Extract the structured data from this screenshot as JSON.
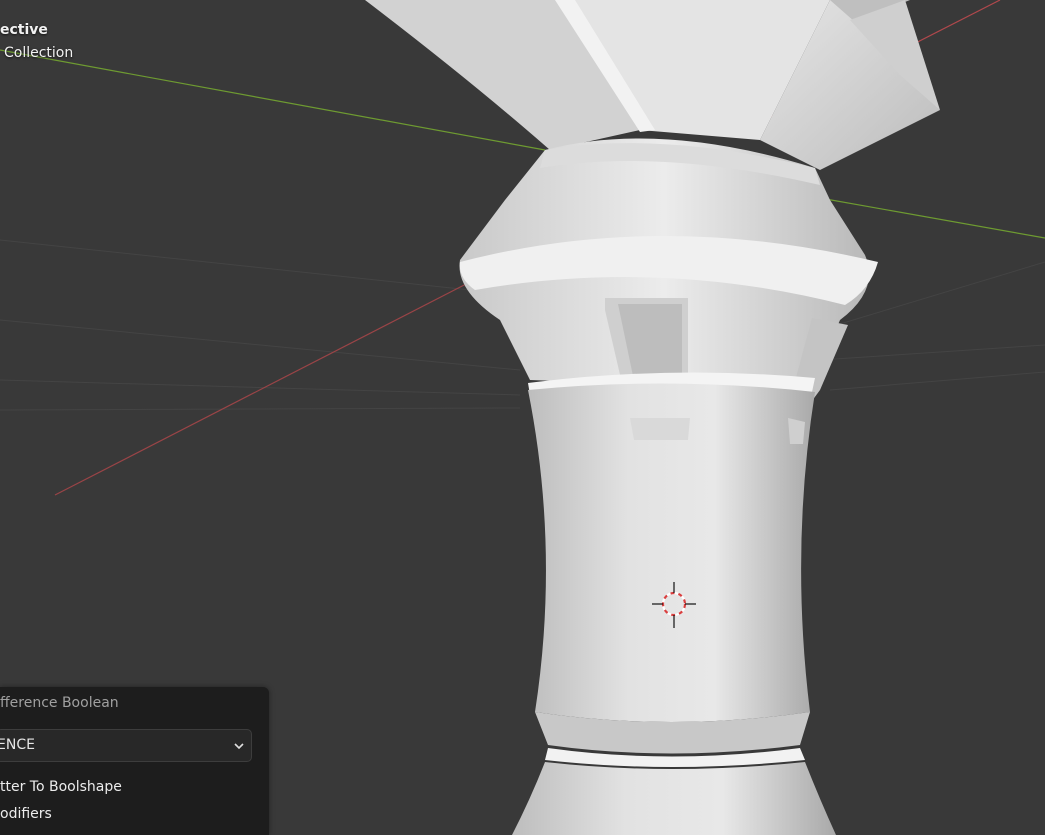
{
  "viewport": {
    "view_mode_label": "ective",
    "collection_label": "Collection"
  },
  "redo_panel": {
    "title": "fference Boolean",
    "operation_value": "ENCE",
    "options": [
      {
        "label": "tter To Boolshape"
      },
      {
        "label": "odifiers"
      }
    ]
  },
  "colors": {
    "background": "#393939",
    "panel": "#1d1d1d",
    "x_axis": "#b0484c",
    "y_axis": "#6e9b31",
    "model": "#d9d9d9"
  }
}
